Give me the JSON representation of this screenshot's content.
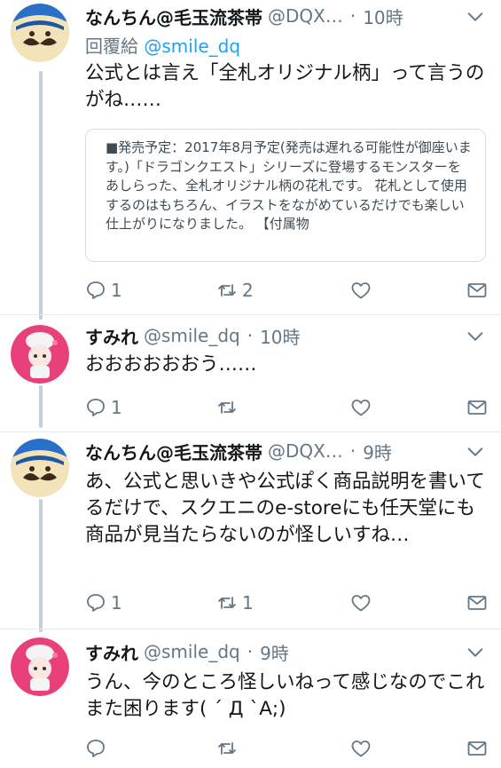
{
  "tweets": [
    {
      "name": "なんちん@毛玉流茶帯",
      "handle": "@DQX…",
      "time": "10時",
      "reply_prefix": "回覆給",
      "reply_mention": "@smile_dq",
      "text": "公式とは言え「全札オリジナル柄」って言うのがね……",
      "card": "■発売予定：2017年8月予定(発売は遅れる可能性が御座います。)「ドラゴンクエスト」シリーズに登場するモンスターをあしらった、全札オリジナル柄の花札です。 花札として使用するのはもちろん、イラストをながめているだけでも楽しい仕上がりになりました。 【付属物",
      "replies": "1",
      "retweets": "2"
    },
    {
      "name": "すみれ",
      "handle": "@smile_dq",
      "time": "10時",
      "text": "おおおおおおう……",
      "replies": "1",
      "retweets": ""
    },
    {
      "name": "なんちん@毛玉流茶帯",
      "handle": "@DQX…",
      "time": "9時",
      "text": "あ、公式と思いきや公式ぽく商品説明を書いてるだけで、スクエニのe-storeにも任天堂にも商品が見当たらないのが怪しいすね…",
      "replies": "1",
      "retweets": "1"
    },
    {
      "name": "すみれ",
      "handle": "@smile_dq",
      "time": "9時",
      "text": "うん、今のところ怪しいねって感じなのでこれまた困ります( ´ Д `A;)",
      "replies": "",
      "retweets": ""
    }
  ],
  "separator": "·",
  "icons": [
    "reply-icon",
    "retweet-icon",
    "like-icon",
    "dm-icon",
    "chevron-down-icon"
  ],
  "colors": {
    "text": "#14171a",
    "secondary": "#657786",
    "link": "#1da1f2",
    "thread": "#c4cfd6"
  }
}
